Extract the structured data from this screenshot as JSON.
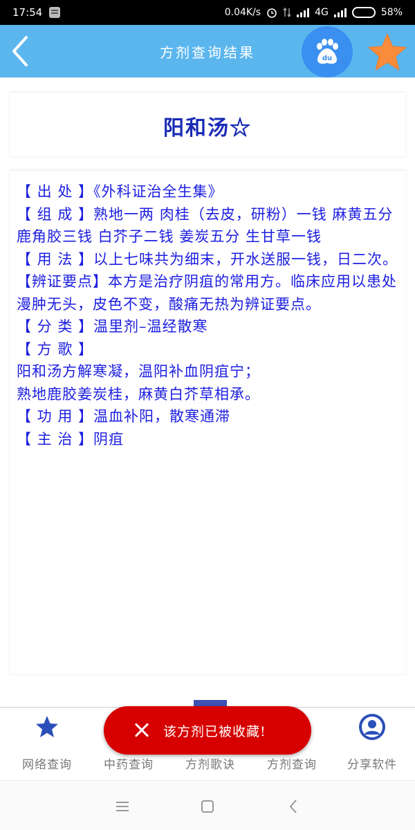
{
  "status_bar": {
    "time": "17:54",
    "speed": "0.04K/s",
    "network": "4G",
    "battery": "58%",
    "battery_level": 0.58
  },
  "header": {
    "title": "方剂查询结果",
    "back_icon": "chevron-left-icon",
    "baidu_icon": "baidu-paw-icon",
    "favorite_icon": "star-icon",
    "bar_color": "#5bb6ee",
    "star_color": "#f88c3a"
  },
  "formula": {
    "name": "阳和汤☆"
  },
  "content": {
    "lines": [
      "【 出 处 】《外科证治全生集》",
      "【 组 成 】熟地一两 肉桂（去皮，研粉）一钱 麻黄五分 鹿角胶三钱 白芥子二钱 姜炭五分 生甘草一钱",
      "【 用 法 】以上七味共为细末，开水送服一钱，日二次。",
      "【辨证要点】本方是治疗阴疽的常用方。临床应用以患处漫肿无头，皮色不变，酸痛无热为辨证要点。",
      "【 分 类 】温里剂–温经散寒",
      "【 方 歌 】",
      "阳和汤方解寒凝，温阳补血阴疽宁；",
      "熟地鹿胶姜炭桂，麻黄白芥草相承。",
      "【 功 用 】温血补阳，散寒通滞",
      "【 主 治 】阴疽"
    ],
    "text_color": "#1c1ee0"
  },
  "bottom_nav": {
    "items": [
      {
        "label": "网络查询",
        "icon": "star-icon"
      },
      {
        "label": "中药查询",
        "icon": ""
      },
      {
        "label": "方剂歌诀",
        "icon": ""
      },
      {
        "label": "方剂查询",
        "icon": ""
      },
      {
        "label": "分享软件",
        "icon": "user-icon"
      }
    ]
  },
  "toast": {
    "message": "该方剂已被收藏!",
    "color": "#d60000",
    "icon": "close-icon"
  }
}
